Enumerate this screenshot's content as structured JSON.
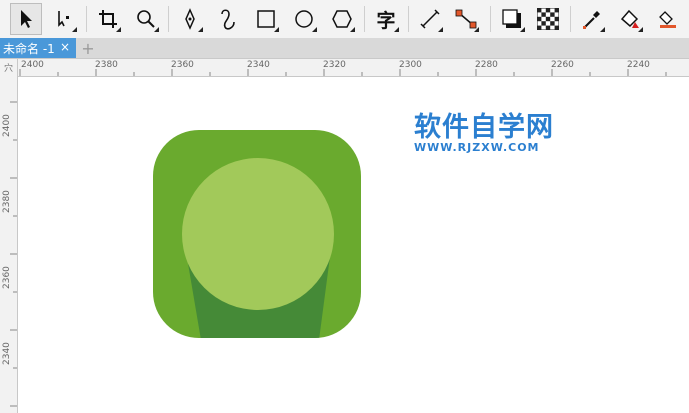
{
  "toolbar": {
    "tools": [
      {
        "name": "pick-tool",
        "icon": "arrow-pointer-icon",
        "active": true
      },
      {
        "name": "shape-tool",
        "icon": "node-edit-icon"
      },
      {
        "name": "crop-tool",
        "icon": "crop-icon"
      },
      {
        "name": "zoom-tool",
        "icon": "magnifier-icon"
      },
      {
        "name": "freehand-tool",
        "icon": "pen-nib-icon"
      },
      {
        "name": "artistic-media-tool",
        "icon": "curve-icon"
      },
      {
        "name": "rectangle-tool",
        "icon": "square-icon"
      },
      {
        "name": "ellipse-tool",
        "icon": "circle-icon"
      },
      {
        "name": "polygon-tool",
        "icon": "hexagon-icon"
      },
      {
        "name": "text-tool",
        "icon": "text-icon",
        "label": "字"
      },
      {
        "name": "dimension-tool",
        "icon": "dimension-line-icon"
      },
      {
        "name": "connector-tool",
        "icon": "connector-icon"
      },
      {
        "name": "drop-shadow-tool",
        "icon": "shadow-icon"
      },
      {
        "name": "transparency-tool",
        "icon": "checkerboard-icon"
      },
      {
        "name": "color-eyedropper-tool",
        "icon": "eyedropper-icon"
      },
      {
        "name": "interactive-fill-tool",
        "icon": "fill-bucket-icon"
      },
      {
        "name": "smart-fill-tool",
        "icon": "smart-fill-icon"
      }
    ]
  },
  "tabs": {
    "active_label": "未命名 -1",
    "close_symbol": "×",
    "add_symbol": "+"
  },
  "rulers": {
    "corner_label": "穴",
    "horizontal": [
      "2400",
      "2380",
      "2360",
      "2340",
      "2320",
      "2300",
      "2280",
      "2260",
      "2240"
    ],
    "vertical": [
      "2400",
      "2380",
      "2360",
      "2340"
    ]
  },
  "watermark": {
    "title": "软件自学网",
    "subtitle": "WWW.RJZXW.COM"
  },
  "colors": {
    "icon_outer": "#6aaa2e",
    "icon_shadow": "#458a37",
    "icon_circle": "#a2c95a",
    "tab_active": "#4a98d9",
    "watermark": "#2b7fd0"
  }
}
